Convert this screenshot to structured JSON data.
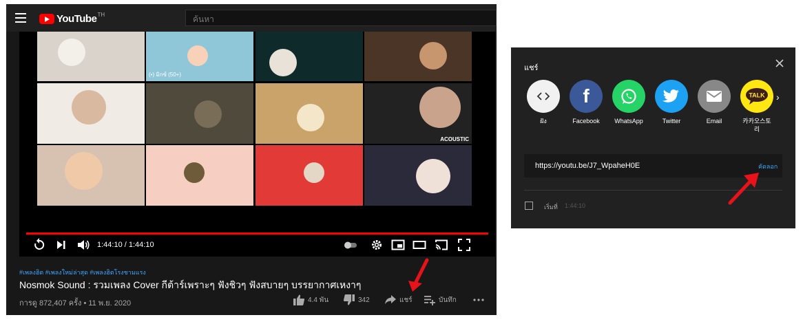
{
  "youtube": {
    "logo_text": "YouTube",
    "logo_region": "TH",
    "search_placeholder": "ค้นหา",
    "thumbnails": [
      {
        "badge": "",
        "caption": "",
        "bg": "#d9d3cc"
      },
      {
        "badge": "(•) มิกซ์ (50+)",
        "caption": "",
        "bg": "#8fc6d8"
      },
      {
        "badge": "",
        "caption": "",
        "bg": "#0f2a2a"
      },
      {
        "badge": "",
        "caption": "",
        "bg": "#4a3527"
      },
      {
        "badge": "",
        "caption": "",
        "bg": "#f0ebe4"
      },
      {
        "badge": "",
        "caption": "",
        "bg": "#4f4a3c"
      },
      {
        "badge": "",
        "caption": "",
        "bg": "#c9a36a"
      },
      {
        "badge": "",
        "caption": "ACOUSTIC",
        "bg": "#222222"
      },
      {
        "badge": "",
        "caption": "",
        "bg": "#d7c2b2"
      },
      {
        "badge": "",
        "caption": "",
        "bg": "#f6cfc2"
      },
      {
        "badge": "",
        "caption": "",
        "bg": "#e23b37"
      },
      {
        "badge": "",
        "caption": "",
        "bg": "#2a2a3a"
      }
    ],
    "player": {
      "time": "1:44:10 / 1:44:10",
      "progress": 1.0
    },
    "video": {
      "tags": "#เพลงฮิต #เพลงใหม่ล่าสุด #เพลงฮิตโรงชามแรง",
      "title": "Nosmok Sound : รวมเพลง Cover กีต้าร์เพราะๆ ฟังชิวๆ ฟังสบายๆ บรรยากาศเหงาๆ",
      "views": "การดู 872,407 ครั้ง • 11 พ.ย. 2020",
      "like_count": "4.4 พัน",
      "dislike_count": "342",
      "share_label": "แชร์",
      "save_label": "บันทึก"
    }
  },
  "share_dialog": {
    "title": "แชร์",
    "options": [
      {
        "label": "ฝัง",
        "icon": "embed-icon",
        "color": "#f1f1f1"
      },
      {
        "label": "Facebook",
        "icon": "facebook-icon",
        "color": "#3b5998"
      },
      {
        "label": "WhatsApp",
        "icon": "whatsapp-icon",
        "color": "#25d366"
      },
      {
        "label": "Twitter",
        "icon": "twitter-icon",
        "color": "#1da1f2"
      },
      {
        "label": "Email",
        "icon": "email-icon",
        "color": "#888888"
      },
      {
        "label": "카카오스토리",
        "icon": "kakaotalk-icon",
        "color": "#ffe812"
      }
    ],
    "url": "https://youtu.be/J7_WpaheH0E",
    "copy_label": "คัดลอก",
    "start_label": "เริ่มที่",
    "start_time": "1:44:10"
  },
  "colors": {
    "accent_red": "#ff0000",
    "link_blue": "#3ea6ff",
    "annotation_red": "#e8121a"
  }
}
